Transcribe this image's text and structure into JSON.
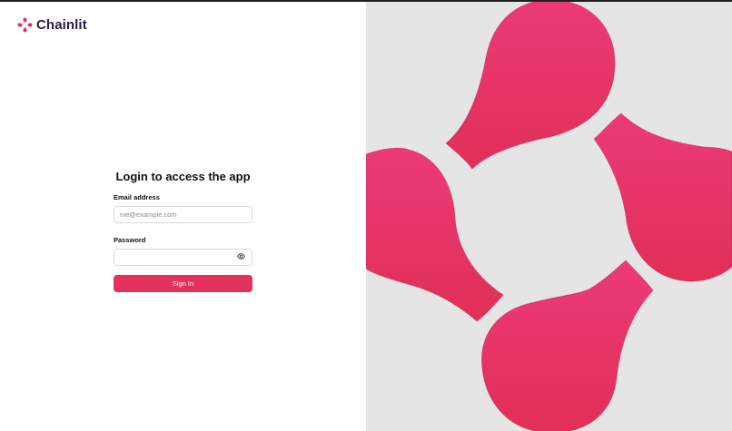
{
  "brand": {
    "name": "Chainlit",
    "logo_icon": "chainlit-logo-icon",
    "accent_color": "#e3325c",
    "text_color": "#2a1b46"
  },
  "login": {
    "title": "Login to access the app",
    "email_label": "Email address",
    "email_placeholder": "me@example.com",
    "email_value": "",
    "password_label": "Password",
    "password_value": "",
    "password_toggle_icon": "eye-icon",
    "submit_label": "Sign In"
  },
  "hero": {
    "background_color": "#e5e5e5",
    "shape_color": "#e8336a",
    "icon": "chainlit-petals-illustration"
  }
}
